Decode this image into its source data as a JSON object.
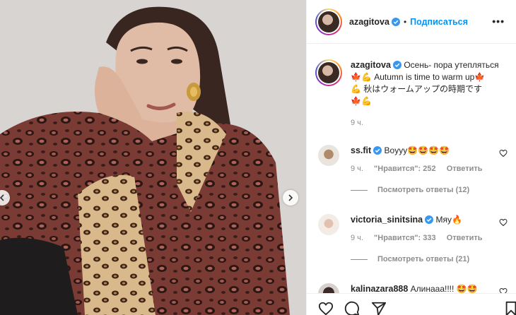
{
  "post": {
    "username": "azagitova",
    "follow_label": "Подписаться",
    "more_label": "•••",
    "caption_line1": "Осень- пора утепляться",
    "caption_line2": "Autumn is time to warm up",
    "caption_line3": "秋はウォームアップの時期です",
    "caption_time": "9 ч."
  },
  "comments": [
    {
      "username": "ss.fit",
      "text": "Boyyy🤩🤩🤩🤩",
      "time": "9 ч.",
      "likes": "\"Нравится\": 252",
      "reply_label": "Ответить",
      "view_replies": "Посмотреть ответы (12)"
    },
    {
      "username": "victoria_sinitsina",
      "text": "Мяу🔥",
      "time": "9 ч.",
      "likes": "\"Нравится\": 333",
      "reply_label": "Ответить",
      "view_replies": "Посмотреть ответы (21)"
    },
    {
      "username": "kalinazara888",
      "text": "Алинааа!!!! 🤩🤩"
    }
  ],
  "icons": {
    "verified": "verified-badge-icon",
    "like": "heart-icon",
    "comment": "comment-icon",
    "share": "paper-plane-icon",
    "save": "bookmark-icon",
    "leaf": "maple-leaf-icon",
    "muscle": "flexed-biceps-icon"
  },
  "colors": {
    "accent": "#0095f6",
    "text": "#262626",
    "muted": "#8e8e8e",
    "verified": "#3897f0"
  }
}
